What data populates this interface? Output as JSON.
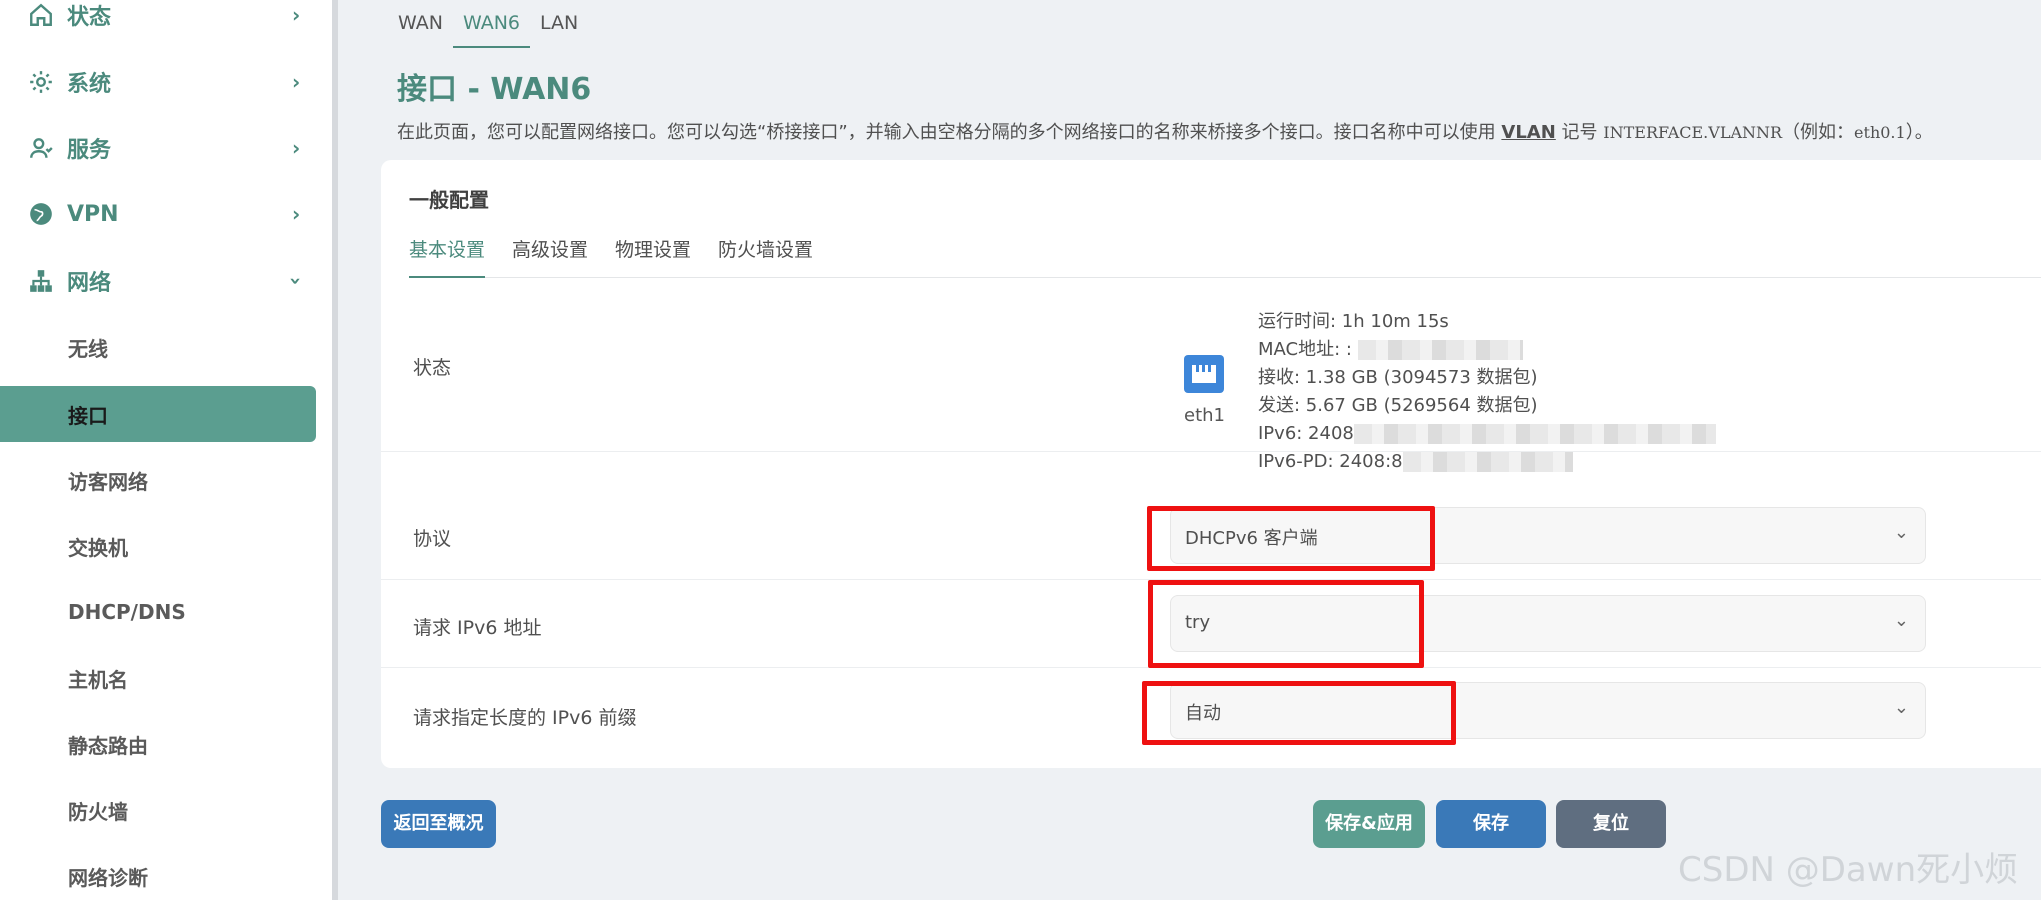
{
  "sidebar": {
    "items": [
      {
        "label": "状态",
        "icon": "home-icon"
      },
      {
        "label": "系统",
        "icon": "gear-icon"
      },
      {
        "label": "服务",
        "icon": "user-icon"
      },
      {
        "label": "VPN",
        "icon": "globe-icon"
      },
      {
        "label": "网络",
        "icon": "network-icon"
      }
    ],
    "sub_items": [
      "无线",
      "接口",
      "访客网络",
      "交换机",
      "DHCP/DNS",
      "主机名",
      "静态路由",
      "防火墙",
      "网络诊断"
    ],
    "active": "接口"
  },
  "top_tabs": [
    "WAN",
    "WAN6",
    "LAN"
  ],
  "active_top_tab": "WAN6",
  "page": {
    "title": "接口 - WAN6",
    "desc_part1": "在此页面，您可以配置网络接口。您可以勾选“桥接接口”，并输入由空格分隔的多个网络接口的名称来桥接多个接口。接口名称中可以使用",
    "desc_vlan": "VLAN",
    "desc_part2": "记号",
    "desc_code": "INTERFACE.VLANNR",
    "desc_part3": "（例如：",
    "desc_example": "eth0.1",
    "desc_part4": "）。"
  },
  "section": {
    "title": "一般配置",
    "tabs": [
      "基本设置",
      "高级设置",
      "物理设置",
      "防火墙设置"
    ],
    "active_tab": "基本设置"
  },
  "status": {
    "label": "状态",
    "port_name": "eth1",
    "uptime": "运行时间: 1h 10m 15s",
    "mac": "MAC地址: :",
    "rx": "接收: 1.38 GB (3094573 数据包)",
    "tx": "发送: 5.67 GB (5269564 数据包)",
    "ipv6": "IPv6: 2408",
    "ipv6_pd": "IPv6-PD: 2408:8"
  },
  "fields": {
    "protocol": {
      "label": "协议",
      "value": "DHCPv6 客户端"
    },
    "request_ipv6": {
      "label": "请求 IPv6 地址",
      "value": "try"
    },
    "prefix_len": {
      "label": "请求指定长度的 IPv6 前缀",
      "value": "自动"
    }
  },
  "buttons": {
    "back": "返回至概况",
    "save_apply": "保存&应用",
    "save": "保存",
    "reset": "复位"
  },
  "watermark": "CSDN @Dawn死小烦",
  "colors": {
    "accent": "#4b8a7d",
    "highlight": "#ee1111",
    "primary": "#3a79b8"
  }
}
